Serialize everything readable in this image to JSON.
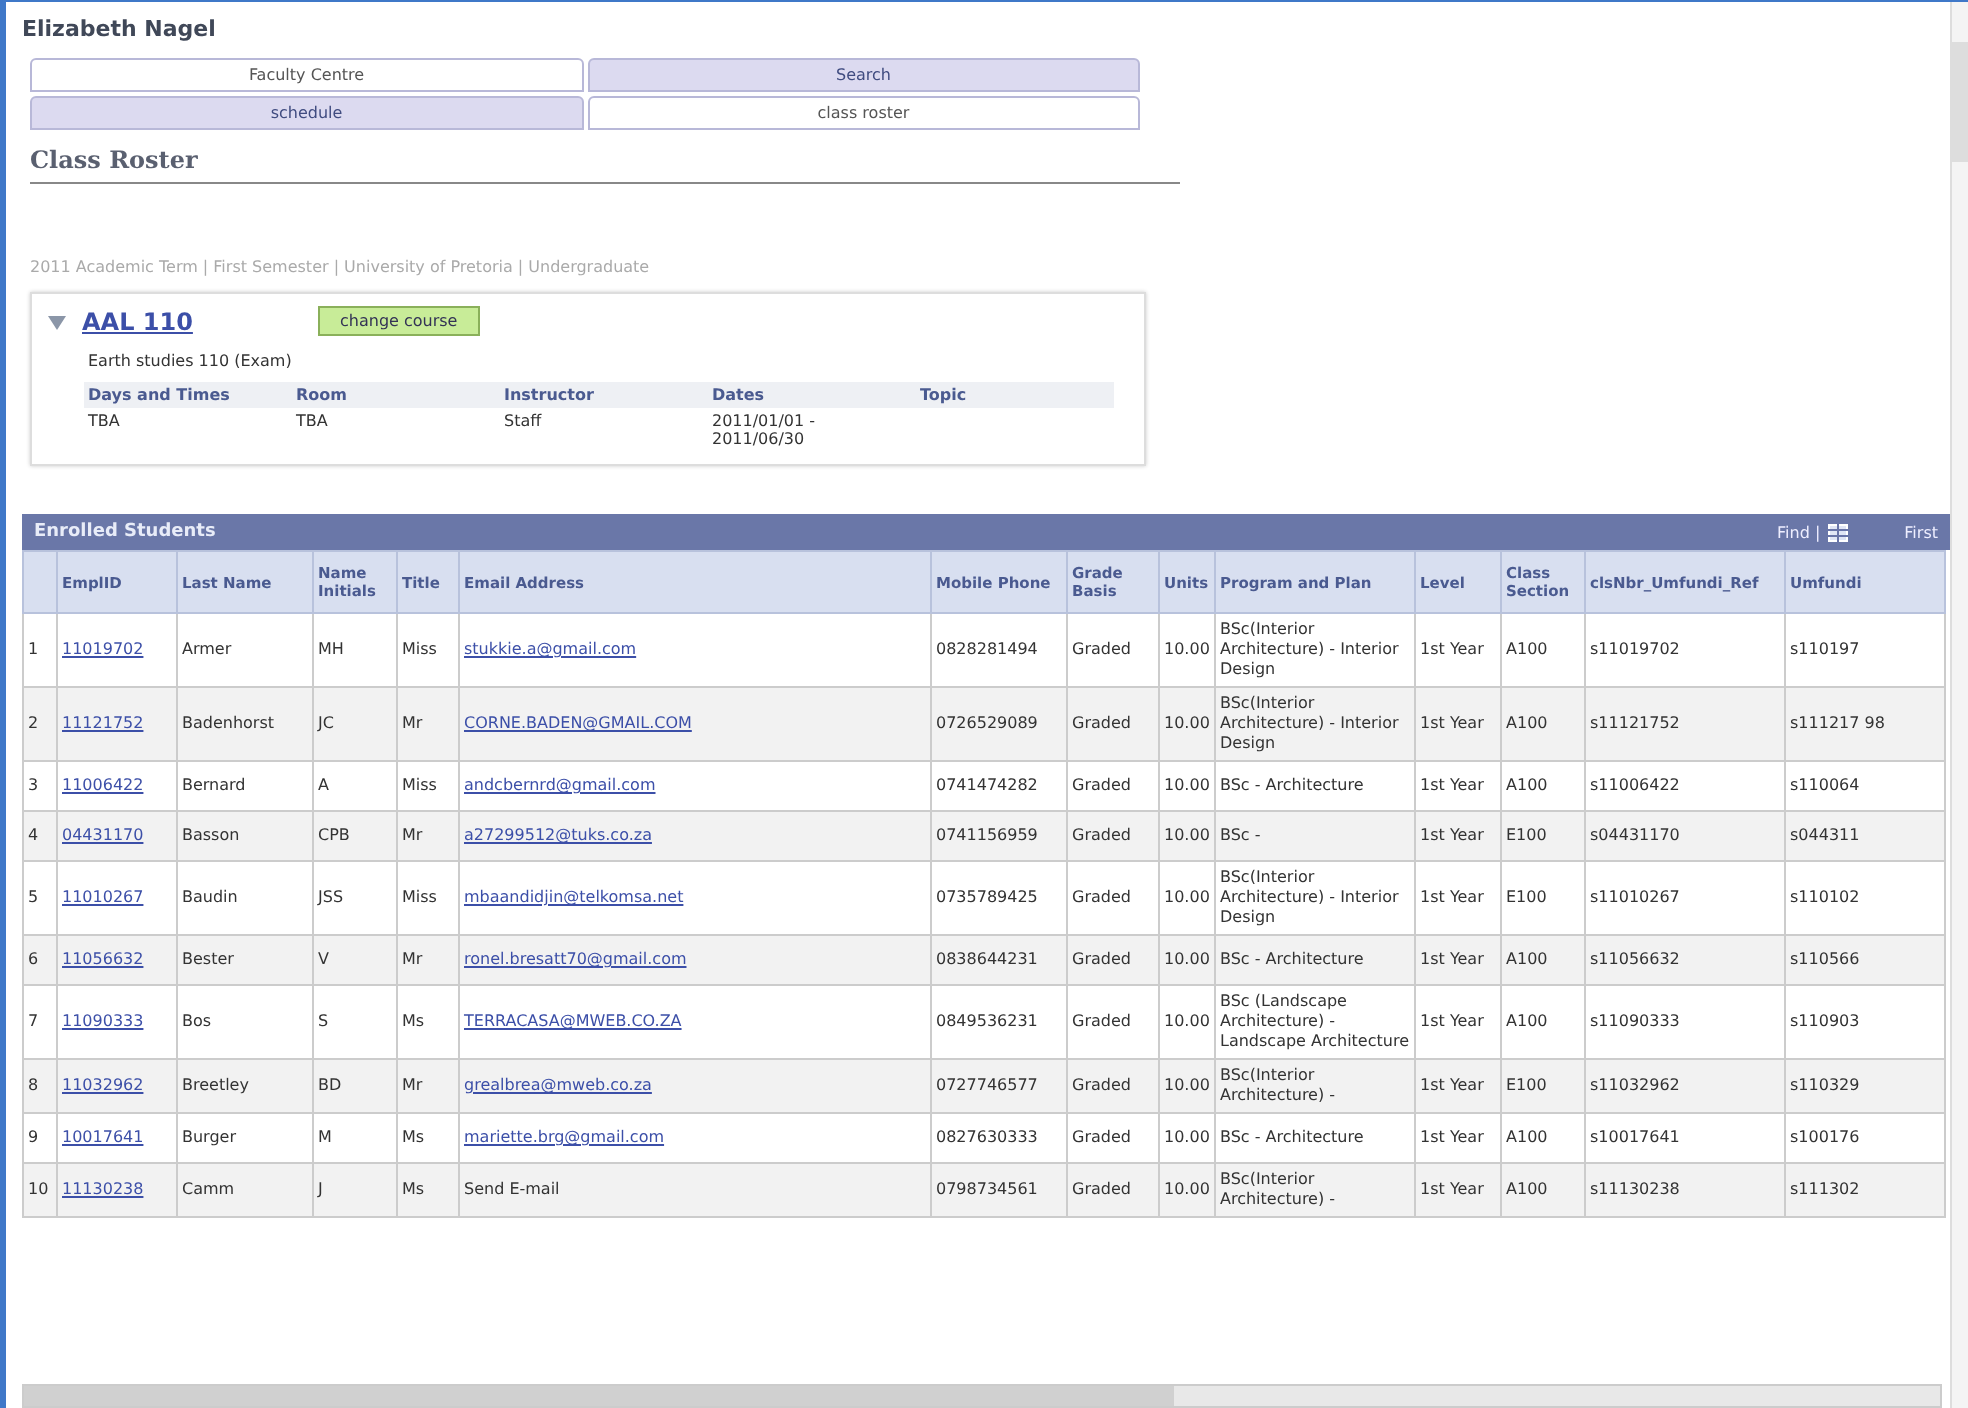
{
  "user_name": "Elizabeth Nagel",
  "tab_rows": [
    [
      {
        "label": "Faculty Centre",
        "selected": true
      },
      {
        "label": "Search",
        "selected": false
      }
    ],
    [
      {
        "label": "schedule",
        "selected": false
      },
      {
        "label": "class roster",
        "selected": true
      }
    ]
  ],
  "page_title": "Class Roster",
  "breadcrumb": "2011 Academic Term | First Semester | University of Pretoria | Undergraduate",
  "course": {
    "expanded": true,
    "code": "AAL 110",
    "button": "change course",
    "description": "Earth studies 110 (Exam)",
    "columns": [
      "Days and Times",
      "Room",
      "Instructor",
      "Dates",
      "Topic"
    ],
    "values": [
      "TBA",
      "TBA",
      "Staff",
      "2011/01/01 - 2011/06/30"
    ]
  },
  "grid": {
    "title": "Enrolled Students",
    "find": "Find |",
    "first": "First",
    "columns": [
      "",
      "EmplID",
      "Last Name",
      "Name Initials",
      "Title",
      "Email Address",
      "Mobile Phone",
      "Grade Basis",
      "Units",
      "Program and Plan",
      "Level",
      "Class Section",
      "clsNbr_Umfundi_Ref",
      "Umfundi"
    ],
    "rows": [
      {
        "cells": [
          "1",
          "11019702",
          "Armer",
          "MH",
          "Miss",
          "stukkie.a@gmail.com",
          "0828281494",
          "Graded",
          "10.00",
          "BSc(Interior Architecture) - Interior Design",
          "1st Year",
          "A100",
          "s11019702",
          "s110197"
        ],
        "email_link": true
      },
      {
        "cells": [
          "2",
          "11121752",
          "Badenhorst",
          "JC",
          "Mr",
          "CORNE.BADEN@GMAIL.COM",
          "0726529089",
          "Graded",
          "10.00",
          "BSc(Interior Architecture) - Interior Design",
          "1st Year",
          "A100",
          "s11121752",
          "s111217 98"
        ],
        "email_link": true
      },
      {
        "cells": [
          "3",
          "11006422",
          "Bernard",
          "A",
          "Miss",
          "andcbernrd@gmail.com",
          "0741474282",
          "Graded",
          "10.00",
          "BSc - Architecture",
          "1st Year",
          "A100",
          "s11006422",
          "s110064"
        ],
        "email_link": true
      },
      {
        "cells": [
          "4",
          "04431170",
          "Basson",
          "CPB",
          "Mr",
          "a27299512@tuks.co.za",
          "0741156959",
          "Graded",
          "10.00",
          "BSc -",
          "1st Year",
          "E100",
          "s04431170",
          "s044311"
        ],
        "email_link": true
      },
      {
        "cells": [
          "5",
          "11010267",
          "Baudin",
          "JSS",
          "Miss",
          "mbaandidjin@telkomsa.net",
          "0735789425",
          "Graded",
          "10.00",
          "BSc(Interior Architecture) - Interior Design",
          "1st Year",
          "E100",
          "s11010267",
          "s110102"
        ],
        "email_link": true
      },
      {
        "cells": [
          "6",
          "11056632",
          "Bester",
          "V",
          "Mr",
          "ronel.bresatt70@gmail.com",
          "0838644231",
          "Graded",
          "10.00",
          "BSc - Architecture",
          "1st Year",
          "A100",
          "s11056632",
          "s110566"
        ],
        "email_link": true
      },
      {
        "cells": [
          "7",
          "11090333",
          "Bos",
          "S",
          "Ms",
          "TERRACASA@MWEB.CO.ZA",
          "0849536231",
          "Graded",
          "10.00",
          "BSc (Landscape Architecture) - Landscape Architecture",
          "1st Year",
          "A100",
          "s11090333",
          "s110903"
        ],
        "email_link": true
      },
      {
        "cells": [
          "8",
          "11032962",
          "Breetley",
          "BD",
          "Mr",
          "grealbrea@mweb.co.za",
          "0727746577",
          "Graded",
          "10.00",
          "BSc(Interior Architecture) -",
          "1st Year",
          "E100",
          "s11032962",
          "s110329"
        ],
        "email_link": true
      },
      {
        "cells": [
          "9",
          "10017641",
          "Burger",
          "M",
          "Ms",
          "mariette.brg@gmail.com",
          "0827630333",
          "Graded",
          "10.00",
          "BSc - Architecture",
          "1st Year",
          "A100",
          "s10017641",
          "s100176"
        ],
        "email_link": true
      },
      {
        "cells": [
          "10",
          "11130238",
          "Camm",
          "J",
          "Ms",
          "Send E-mail",
          "0798734561",
          "Graded",
          "10.00",
          "BSc(Interior Architecture) -",
          "1st Year",
          "A100",
          "s11130238",
          "s111302"
        ],
        "email_link": false
      }
    ]
  }
}
